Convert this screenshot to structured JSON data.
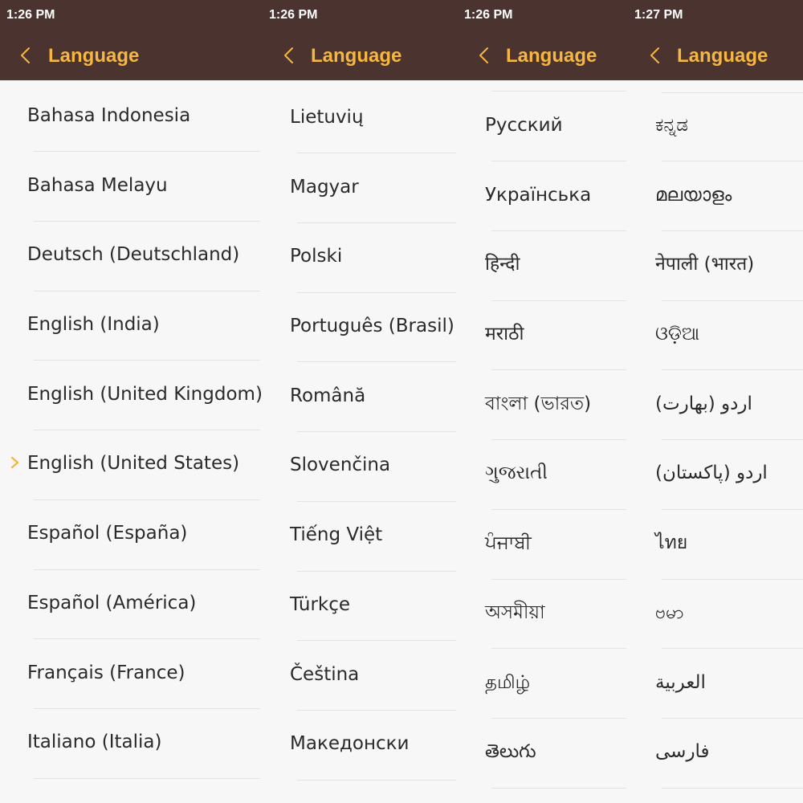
{
  "accent_color": "#f5b642",
  "header_bg_color": "#4b3430",
  "screens": [
    {
      "status_time": "1:26 PM",
      "title": "Language",
      "back_icon": "chevron-left-icon",
      "languages": [
        "Bahasa Indonesia",
        "Bahasa Melayu",
        "Deutsch (Deutschland)",
        "English (India)",
        "English (United Kingdom)",
        "English (United States)",
        "Español (España)",
        "Español (América)",
        "Français (France)",
        "Italiano (Italia)"
      ],
      "selected_language": "English (United States)",
      "selected_icon": "chevron-right-icon"
    },
    {
      "status_time": "1:26 PM",
      "title": "Language",
      "back_icon": "chevron-left-icon",
      "languages": [
        "Lietuvių",
        "Magyar",
        "Polski",
        "Português (Brasil)",
        "Română",
        "Slovenčina",
        "Tiếng Việt",
        "Türkçe",
        "Čeština",
        "Македонски"
      ]
    },
    {
      "status_time": "1:26 PM",
      "title": "Language",
      "back_icon": "chevron-left-icon",
      "languages": [
        "Русский",
        "Українська",
        "हिन्दी",
        "मराठी",
        "বাংলা (ভারত)",
        "ગુજરાતી",
        "ਪੰਜਾਬੀ",
        "অসমীয়া",
        "தமிழ்",
        "తెలుగు"
      ]
    },
    {
      "status_time": "1:27 PM",
      "title": "Language",
      "back_icon": "chevron-left-icon",
      "languages": [
        "ಕನ್ನಡ",
        "മലയാളം",
        "नेपाली (भारत)",
        "ଓଡ଼ିଆ",
        "اردو (بھارت)",
        "اردو (پاکستان)",
        "ไทย",
        "ဗမာ",
        "العربية",
        "فارسی"
      ]
    }
  ]
}
